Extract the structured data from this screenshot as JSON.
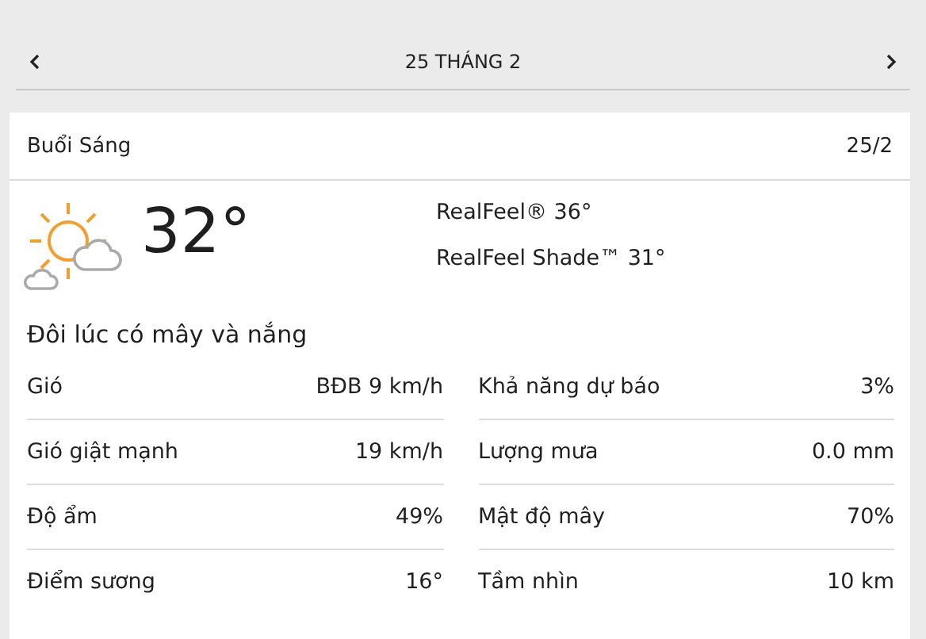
{
  "nav": {
    "title": "25 THÁNG 2"
  },
  "period": {
    "name": "Buổi Sáng",
    "date": "25/2"
  },
  "current": {
    "temperature": "32°",
    "realfeel": "RealFeel® 36°",
    "realfeel_shade": "RealFeel Shade™ 31°",
    "description": "Đôi lúc có mây và nắng"
  },
  "details": [
    [
      {
        "label": "Gió",
        "value": "BĐB 9 km/h"
      },
      {
        "label": "Khả năng dự báo",
        "value": "3%"
      }
    ],
    [
      {
        "label": "Gió giật mạnh",
        "value": "19 km/h"
      },
      {
        "label": "Lượng mưa",
        "value": "0.0 mm"
      }
    ],
    [
      {
        "label": "Độ ẩm",
        "value": "49%"
      },
      {
        "label": "Mật độ mây",
        "value": "70%"
      }
    ],
    [
      {
        "label": "Điểm sương",
        "value": "16°"
      },
      {
        "label": "Tầm nhìn",
        "value": "10 km"
      }
    ]
  ]
}
